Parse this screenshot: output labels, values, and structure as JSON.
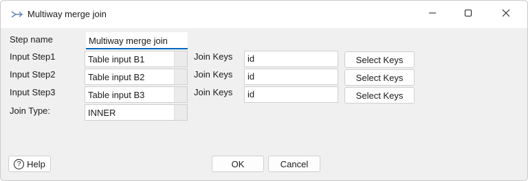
{
  "window": {
    "title": "Multiway merge join",
    "app_icon": "transform-arrow-icon",
    "controls": {
      "minimize": "minimize-icon",
      "maximize": "maximize-icon",
      "close": "close-icon"
    }
  },
  "form": {
    "step_name_label": "Step name",
    "step_name_value": "Multiway merge join",
    "rows": [
      {
        "input_label": "Input Step1",
        "input_value": "Table input B1",
        "keys_label": "Join Keys",
        "keys_value": "id",
        "select_keys_label": "Select Keys"
      },
      {
        "input_label": "Input Step2",
        "input_value": "Table input B2",
        "keys_label": "Join Keys",
        "keys_value": "id",
        "select_keys_label": "Select Keys"
      },
      {
        "input_label": "Input Step3",
        "input_value": "Table input B3",
        "keys_label": "Join Keys",
        "keys_value": "id",
        "select_keys_label": "Select Keys"
      }
    ],
    "join_type_label": "Join Type:",
    "join_type_value": "INNER"
  },
  "footer": {
    "help_label": "Help",
    "help_icon": "help-circle-icon",
    "ok_label": "OK",
    "cancel_label": "Cancel"
  }
}
